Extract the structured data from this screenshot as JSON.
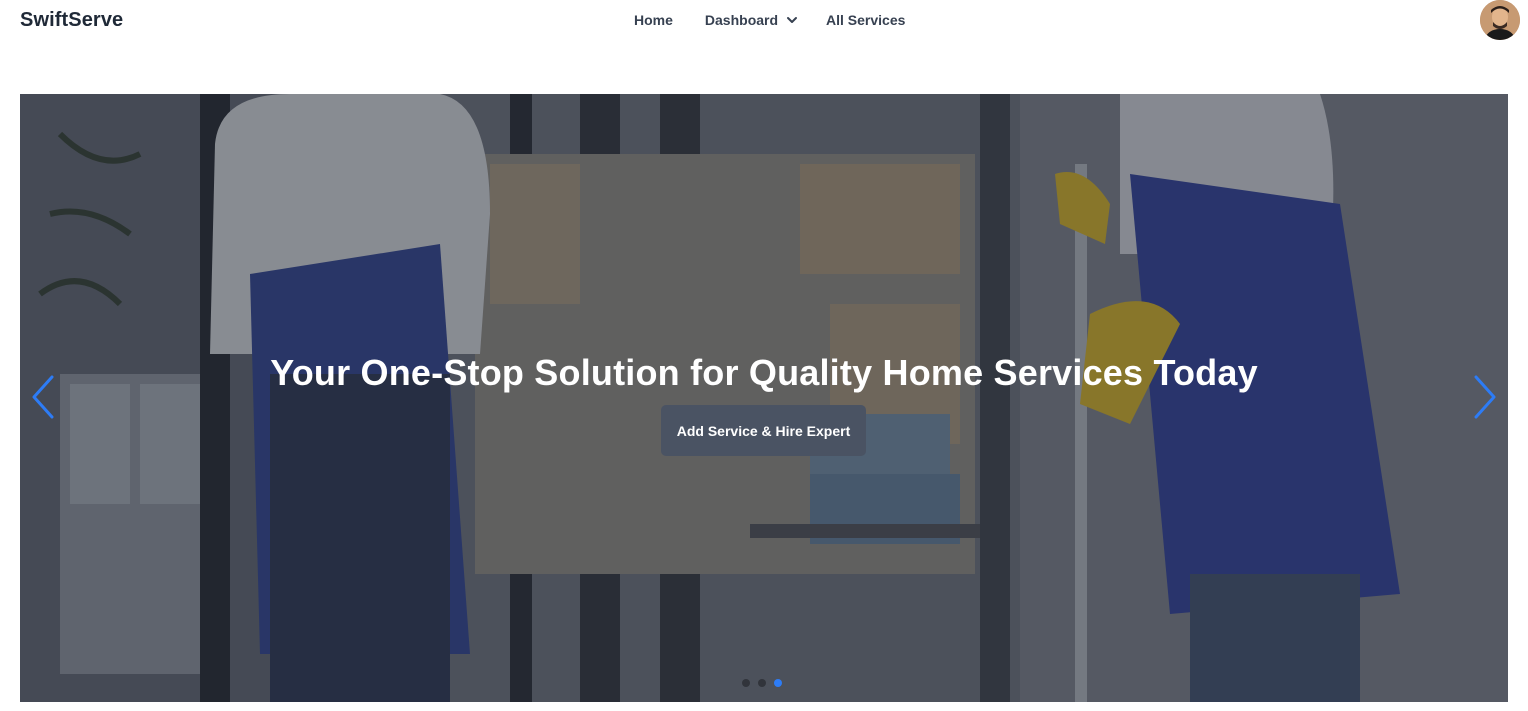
{
  "navbar": {
    "brand": "SwiftServe",
    "links": [
      {
        "label": "Home"
      },
      {
        "label": "Dashboard"
      },
      {
        "label": "All Services"
      }
    ]
  },
  "hero": {
    "title": "Your One-Stop Solution for Quality Home Services Today",
    "button_label": "Add Service & Hire Expert",
    "slides_total": 3,
    "active_slide": 3,
    "accent_color": "#2d7cf6",
    "prev_icon": "chevron-left-icon",
    "next_icon": "chevron-right-icon"
  }
}
